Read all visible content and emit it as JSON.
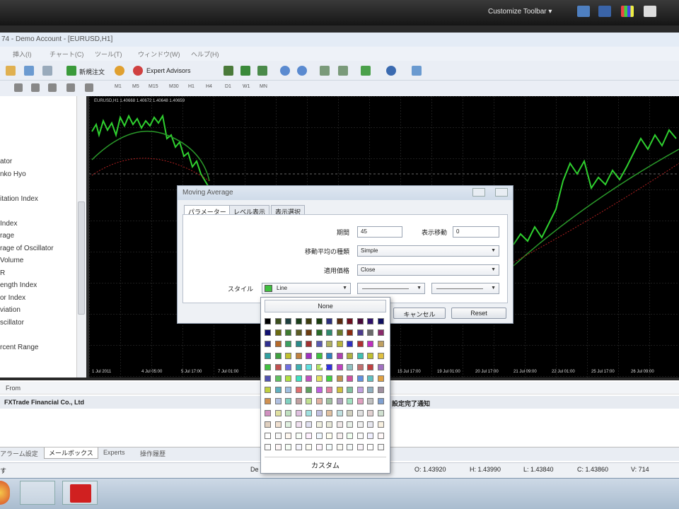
{
  "os_bar": {
    "customize_label": "Customize Toolbar"
  },
  "window": {
    "title": "74 - Demo Account - [EURUSD,H1]"
  },
  "menu": {
    "items": [
      "挿入(I)",
      "チャート(C)",
      "ツール(T)",
      "ウィンドウ(W)",
      "ヘルプ(H)"
    ]
  },
  "toolbar": {
    "new_order_label": "新規注文",
    "expert_advisors_label": "Expert Advisors",
    "timeframes": [
      "M1",
      "M5",
      "M15",
      "M30",
      "H1",
      "H4",
      "D1",
      "W1",
      "MN"
    ]
  },
  "navigator": {
    "items": [
      "ator",
      "nko Hyo",
      "itation Index",
      "Index",
      "rage",
      "rage of Oscillator",
      "Volume",
      "R",
      "ength Index",
      "or Index",
      "viation",
      "scillator",
      "rcent Range"
    ]
  },
  "chart": {
    "header": "EURUSD,H1  1.40668 1.40672 1.40648 1.40659",
    "x_labels": [
      "1 Jul 2011",
      "4 Jul 05:00",
      "5 Jul 17:00",
      "7 Jul 01:00",
      "15 Jul 17:00",
      "19 Jul 01:00",
      "20 Jul 17:00",
      "21 Jul 09:00",
      "22 Jul 01:00",
      "25 Jul 17:00",
      "26 Jul 09:00"
    ]
  },
  "terminal": {
    "col_from": "From",
    "row_from": "FXTrade Financial Co., Ltd",
    "row_subject": "設定完了通知",
    "tabs": [
      "アラーム設定",
      "メールボックス",
      "Experts",
      "操作履歴"
    ]
  },
  "status": {
    "left": "す",
    "default": "De",
    "open": "O: 1.43920",
    "high": "H: 1.43990",
    "low": "L: 1.43840",
    "close": "C: 1.43860",
    "volume": "V: 714"
  },
  "dialog": {
    "title": "Moving Average",
    "tabs": [
      "パラメーター",
      "レベル表示",
      "表示選択"
    ],
    "period_label": "期間",
    "period_value": "45",
    "shift_label": "表示移動",
    "shift_value": "0",
    "method_label": "移動平均の種類",
    "method_value": "Simple",
    "apply_label": "適用価格",
    "apply_value": "Close",
    "style_label": "スタイル",
    "style_value": "Line",
    "cancel_label": "キャンセル",
    "reset_label": "Reset"
  },
  "palette": {
    "none_label": "None",
    "custom_label": "カスタム",
    "colors": [
      [
        "#000000",
        "#3c4f1f",
        "#1e3f3f",
        "#1b3f1b",
        "#3d3d10",
        "#1a3d10",
        "#2b2f7c",
        "#5a2a10",
        "#6d1020",
        "#470a3a",
        "#2e106a",
        "#101060"
      ],
      [
        "#101070",
        "#6b6b10",
        "#3d7a30",
        "#5b5b23",
        "#6b3b10",
        "#286b28",
        "#2e8a6e",
        "#6b7b2a",
        "#8a2a10",
        "#4b3b8b",
        "#6a6a6a",
        "#8a2a6a"
      ],
      [
        "#303090",
        "#b56a2a",
        "#3aa060",
        "#2a8a8a",
        "#a03030",
        "#5a5ab0",
        "#b0b060",
        "#b8b43a",
        "#3030c0",
        "#b03030",
        "#c030c0",
        "#c0a060"
      ],
      [
        "#30a0a0",
        "#3fa03f",
        "#c0c030",
        "#c08040",
        "#a030c0",
        "#40c040",
        "#3080c0",
        "#b040b0",
        "#b0b040",
        "#40c0b0",
        "#c0c030",
        "#e0c040"
      ],
      [
        "#40c040",
        "#c05050",
        "#7070e0",
        "#40b0b0",
        "#60e0e0",
        "#b0e060",
        "#3030e0",
        "#c040c0",
        "#90c0c0",
        "#c07070",
        "#c04040",
        "#a070c0"
      ],
      [
        "#5050b0",
        "#60c060",
        "#b0e040",
        "#40e0c0",
        "#c050c0",
        "#e0e060",
        "#40d040",
        "#c09050",
        "#d050a0",
        "#6090e0",
        "#60c0c0",
        "#e0a040"
      ],
      [
        "#c0d040",
        "#60b0c0",
        "#a0c0e0",
        "#e07070",
        "#60a060",
        "#c060e0",
        "#e080a0",
        "#d0c040",
        "#80c0a0",
        "#c0a0e0",
        "#90b0c0",
        "#a090a0"
      ],
      [
        "#d09050",
        "#b0c0e0",
        "#80d0c0",
        "#c0a0a0",
        "#c0e090",
        "#e0b0a0",
        "#a0c0a0",
        "#b0a0c0",
        "#a0e0c0",
        "#e0a0c0",
        "#c0c0c0",
        "#80a0d0"
      ],
      [
        "#d090c0",
        "#e0e0a0",
        "#c0e0c0",
        "#e0c0e0",
        "#a0e0e0",
        "#c0c0e0",
        "#e0c0a0",
        "#c0e0e0",
        "#d0d0c0",
        "#e0e0e0",
        "#e0d0d0",
        "#d0e0d0"
      ],
      [
        "#e0d0c0",
        "#f0e0d0",
        "#e0f0e0",
        "#f0e0f0",
        "#e0e0f0",
        "#f0f0e0",
        "#e8e8d8",
        "#f0e8e8",
        "#e8f0e8",
        "#f0f0f0",
        "#e8e8f0",
        "#f8f0e0"
      ],
      [
        "#ffffff",
        "#f8f8f8",
        "#fff8f0",
        "#f8fff8",
        "#fff0ff",
        "#f0f8ff",
        "#fffff0",
        "#f8f0f0",
        "#f0fff0",
        "#fafafa",
        "#f0f0ff",
        "#fff8f8"
      ],
      [
        "#fafafa",
        "#fdf5f5",
        "#f5fdf5",
        "#f5f5fd",
        "#fdfdf5",
        "#fdf5fd",
        "#f5fdfd",
        "#fafaf5",
        "#f5fafa",
        "#faf5fa",
        "#ffffff",
        "#f8f8f8"
      ]
    ]
  }
}
